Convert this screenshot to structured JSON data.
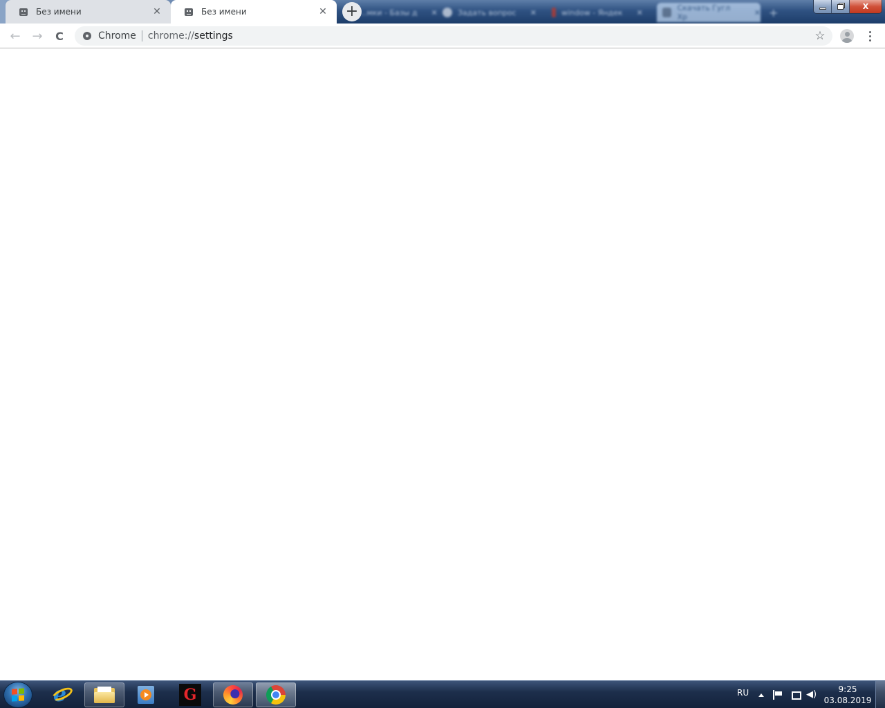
{
  "browser": {
    "tabs": [
      {
        "title": "Без имени",
        "state": "inactive",
        "favicon": "sad-face-icon"
      },
      {
        "title": "Без имени",
        "state": "active",
        "favicon": "sad-face-icon"
      }
    ],
    "new_tab_icon": "+",
    "close_glyph": "✕",
    "background_window_tabs": [
      {
        "title": "...мки - Базы д",
        "favicon_color": "#8fa5c4"
      },
      {
        "title": "Задать вопрос",
        "favicon_color": "#d6dde8"
      },
      {
        "title": "window - Яндек",
        "favicon_color": "#c0392b"
      },
      {
        "title": "Скачать Гугл Хр",
        "favicon_color": "#6d7f96",
        "highlighted": true
      }
    ],
    "window_controls": {
      "close_glyph": "X"
    },
    "toolbar": {
      "back_icon": "←",
      "forward_icon": "→",
      "reload_icon": "C",
      "omnibox": {
        "security_chip": "Chrome",
        "url_scheme": "chrome://",
        "url_host": "settings"
      },
      "bookmark_icon": "☆"
    }
  },
  "taskbar": {
    "pinned_apps": [
      {
        "name": "Internet Explorer"
      },
      {
        "name": "Windows Explorer"
      },
      {
        "name": "Windows Media Player"
      },
      {
        "name": "Garena",
        "glyph": "G"
      },
      {
        "name": "Firefox"
      },
      {
        "name": "Google Chrome"
      }
    ],
    "tray": {
      "language": "RU",
      "volume_glyph": "🔊",
      "time": "9:25",
      "date": "03.08.2019"
    }
  }
}
